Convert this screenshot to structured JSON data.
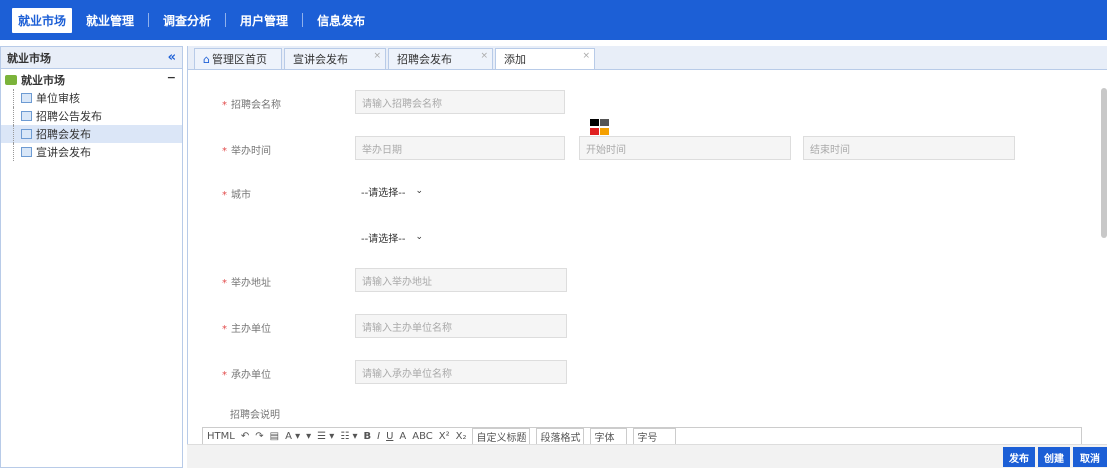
{
  "topnav": [
    "就业市场",
    "就业管理",
    "调查分析",
    "用户管理",
    "信息发布"
  ],
  "sidebar": {
    "title": "就业市场",
    "collapse": "«",
    "root": "就业市场",
    "root_toggle": "−",
    "items": [
      "单位审核",
      "招聘公告发布",
      "招聘会发布",
      "宣讲会发布"
    ]
  },
  "tabs": [
    "管理区首页",
    "宣讲会发布",
    "招聘会发布",
    "添加"
  ],
  "tab_close": "×",
  "form": {
    "name_label": "招聘会名称",
    "name_placeholder": "请输入招聘会名称",
    "time_label": "举办时间",
    "date_placeholder": "举办日期",
    "start_placeholder": "开始时间",
    "end_placeholder": "结束时间",
    "city_label": "城市",
    "city_select": "--请选择--",
    "district_select": "--请选择--",
    "addr_label": "举办地址",
    "addr_placeholder": "请输入举办地址",
    "host_label": "主办单位",
    "host_placeholder": "请输入主办单位名称",
    "co_label": "承办单位",
    "co_placeholder": "请输入承办单位名称",
    "desc_label": "招聘会说明"
  },
  "editor": {
    "tools": [
      "HTML",
      "↶",
      "↷",
      "▤",
      "A ▾",
      "▾",
      "☰ ▾",
      "☷ ▾",
      "B",
      "I",
      "U",
      "A",
      "ABC",
      "X²",
      "X₂"
    ],
    "title_select": "自定义标题",
    "para_select": "段落格式",
    "font_select": "字体",
    "size_select": "字号"
  },
  "buttons": {
    "publish": "发布",
    "create": "创建",
    "cancel": "取消"
  },
  "colors": {
    "accent": "#1c5fd6"
  }
}
